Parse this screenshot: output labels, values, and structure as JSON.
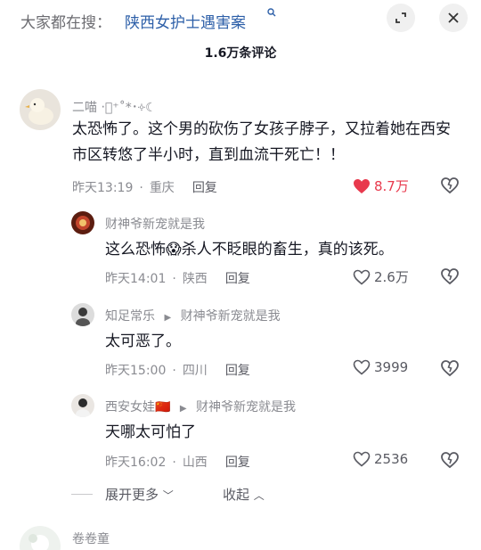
{
  "header": {
    "search_prefix": "大家都在搜：",
    "search_query": "陕西女护士遇害案",
    "title": "1.6万条评论"
  },
  "comments": [
    {
      "name": "二喵 ‧͙⁺˚*･༓☾",
      "text": "太恐怖了。这个男的砍伤了女孩子脖子，又拉着她在西安市区转悠了半小时，直到血流干死亡！！",
      "time": "昨天13:19",
      "location": "重庆",
      "reply_label": "回复",
      "likes": "8.7万",
      "liked": true
    }
  ],
  "replies": [
    {
      "name": "财神爷新宠就是我",
      "text": "这么恐怖😱杀人不眨眼的畜生，真的该死。",
      "time": "昨天14:01",
      "location": "陕西",
      "reply_label": "回复",
      "likes": "2.6万"
    },
    {
      "name": "知足常乐",
      "reply_to": "财神爷新宠就是我",
      "text": "太可恶了。",
      "time": "昨天15:00",
      "location": "四川",
      "reply_label": "回复",
      "likes": "3999"
    },
    {
      "name": "西安女娃🇨🇳",
      "reply_to": "财神爷新宠就是我",
      "text": "天哪太可怕了",
      "time": "昨天16:02",
      "location": "山西",
      "reply_label": "回复",
      "likes": "2536"
    }
  ],
  "thread_controls": {
    "expand_label": "展开更多",
    "collapse_label": "收起"
  },
  "next_comment": {
    "name": "卷卷童"
  },
  "colors": {
    "liked_heart": "#e8394d",
    "link": "#2d5fa8",
    "muted": "#8a8b91"
  }
}
